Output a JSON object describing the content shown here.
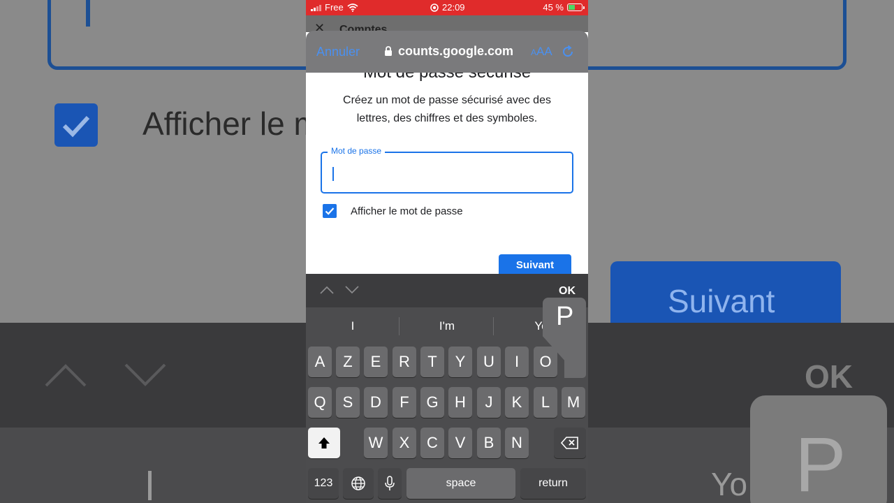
{
  "status_bar": {
    "carrier": "Free",
    "time": "22:09",
    "battery": "45 %"
  },
  "underlying_page": {
    "title": "Comptes"
  },
  "browser_bar": {
    "cancel": "Annuler",
    "url": "counts.google.com",
    "text_size": "AA",
    "text_size_small": "A"
  },
  "page": {
    "heading": "Mot de passe sécurisé",
    "description": "Créez un mot de passe sécurisé avec des lettres, des chiffres et des symboles.",
    "password_label": "Mot de passe",
    "password_value": "",
    "show_password_label": "Afficher le mot de passe",
    "show_password_checked": true,
    "next_button": "Suivant"
  },
  "keyboard_accessory": {
    "ok": "OK"
  },
  "keyboard": {
    "predictions": [
      "I",
      "I'm",
      "Yo"
    ],
    "row1": [
      "A",
      "Z",
      "E",
      "R",
      "T",
      "Y",
      "U",
      "I",
      "O",
      "P"
    ],
    "row2": [
      "Q",
      "S",
      "D",
      "F",
      "G",
      "H",
      "J",
      "K",
      "L",
      "M"
    ],
    "row3": [
      "W",
      "X",
      "C",
      "V",
      "B",
      "N"
    ],
    "numbers": "123",
    "space": "space",
    "return": "return",
    "popup_key": "P"
  },
  "colors": {
    "accent": "#1a73e8",
    "status_bar": "#e02b2b",
    "ios_link": "#4a90f0"
  },
  "icons": [
    "wifi-icon",
    "record-icon",
    "battery-icon",
    "lock-icon",
    "reload-icon",
    "check-icon",
    "chevron-up-icon",
    "chevron-down-icon",
    "shift-icon",
    "delete-icon",
    "globe-icon",
    "mic-icon"
  ]
}
